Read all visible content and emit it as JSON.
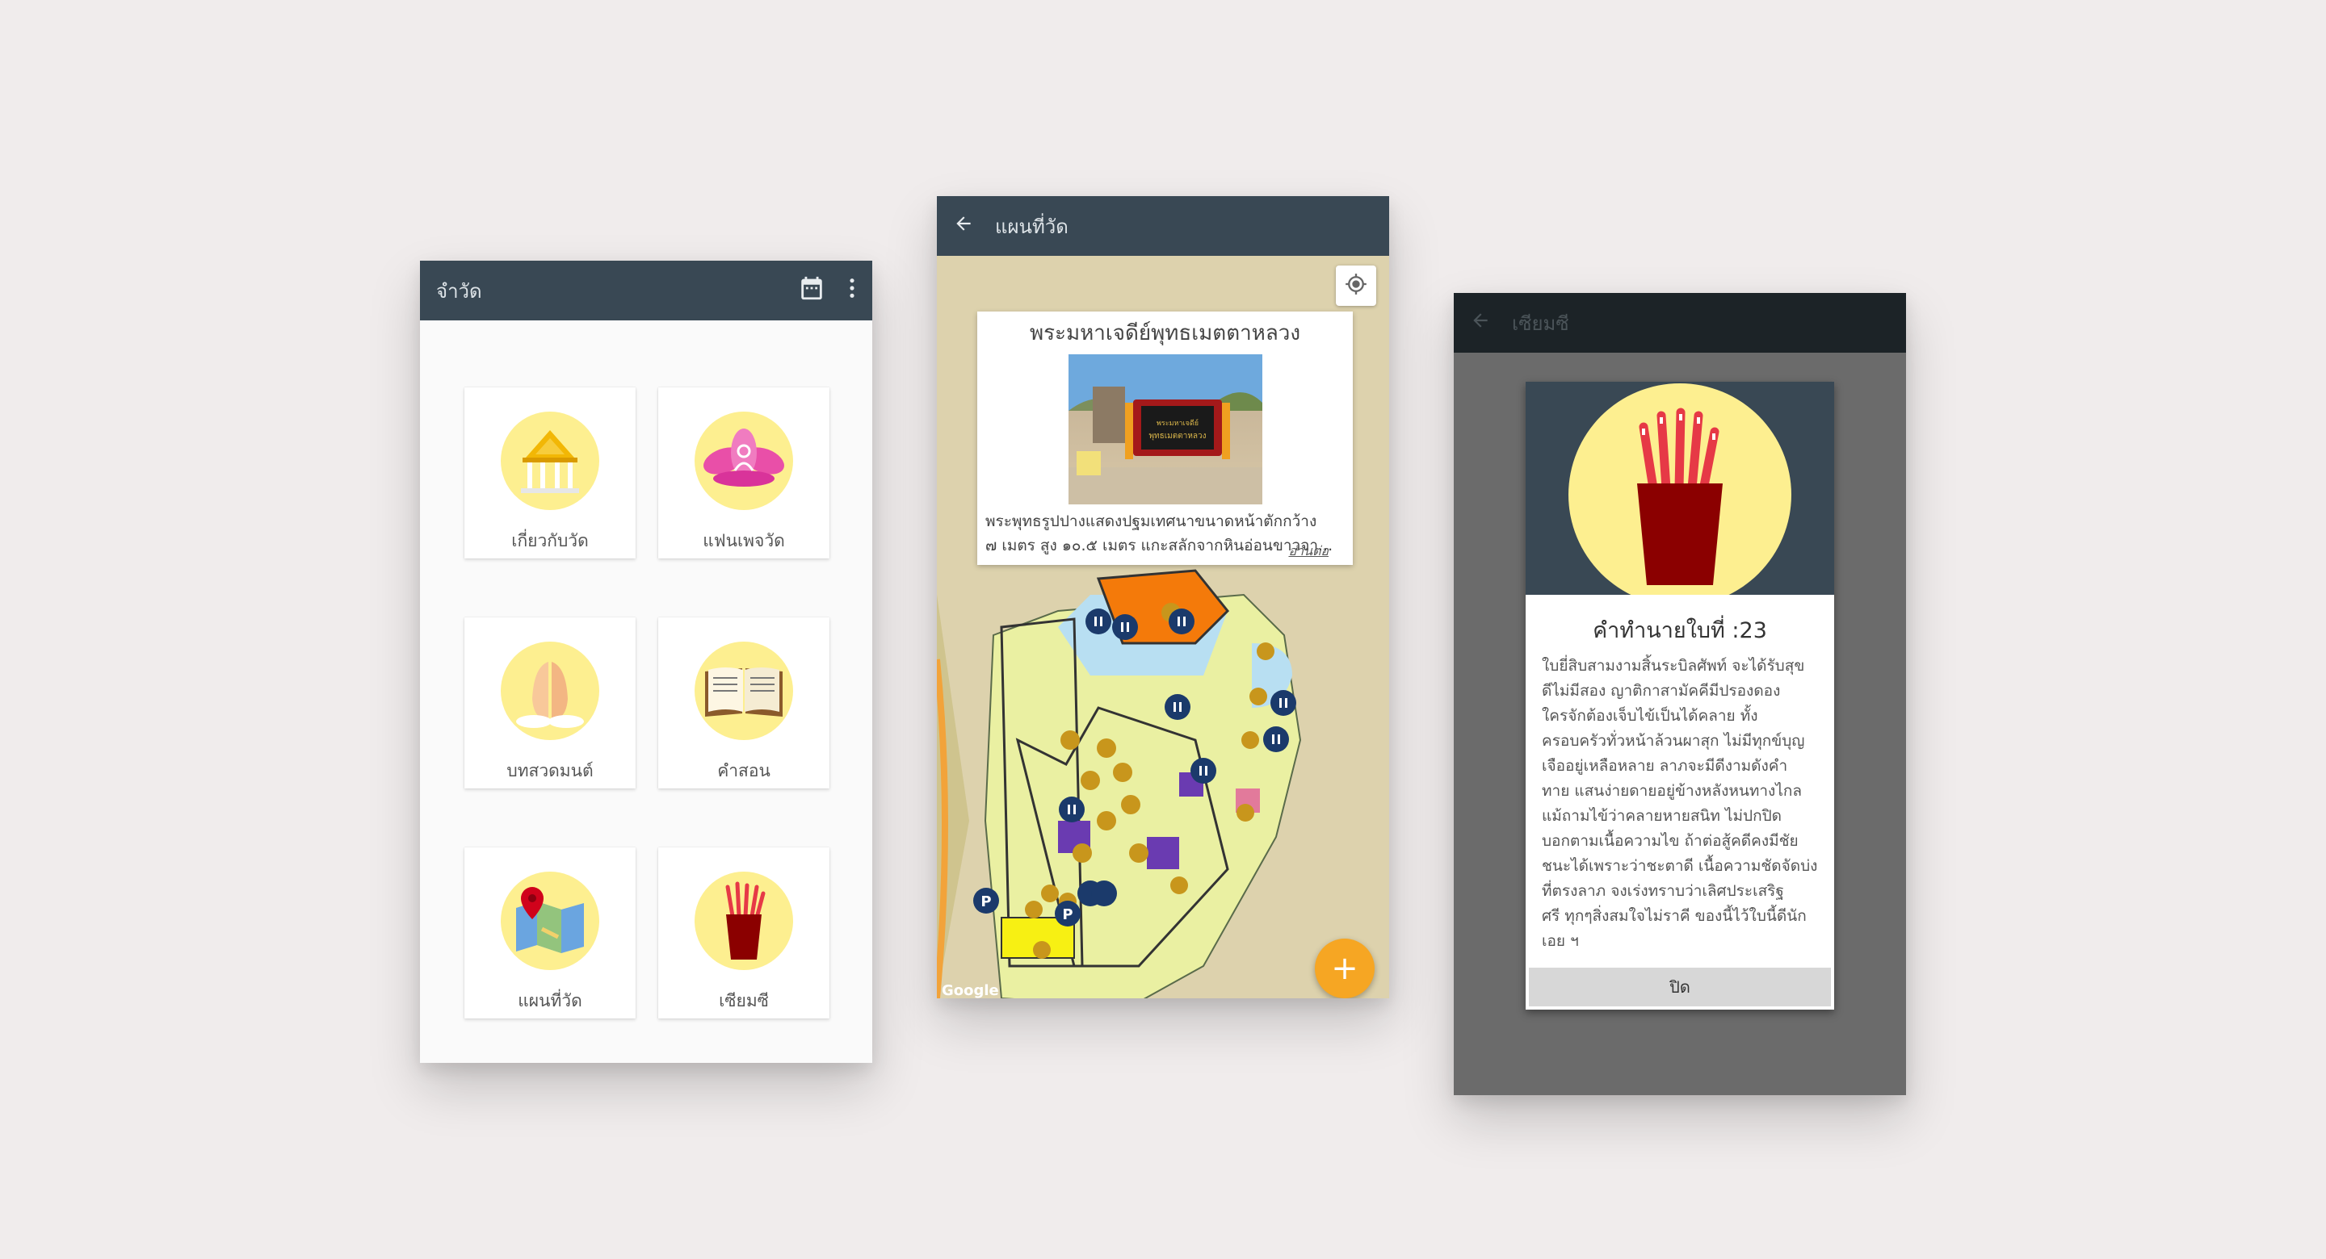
{
  "home": {
    "title": "จำวัด",
    "cards": [
      {
        "label": "เกี่ยวกับวัด",
        "icon": "temple-icon"
      },
      {
        "label": "แฟนเพจวัด",
        "icon": "lotus-icon"
      },
      {
        "label": "บทสวดมนต์",
        "icon": "praying-hands-icon"
      },
      {
        "label": "คำสอน",
        "icon": "book-icon"
      },
      {
        "label": "แผนที่วัด",
        "icon": "map-icon"
      },
      {
        "label": "เซียมซี",
        "icon": "fortune-sticks-icon"
      }
    ]
  },
  "map": {
    "title": "แผนที่วัด",
    "info": {
      "title": "พระมหาเจดีย์พุทธเมตตาหลวง",
      "line1": "พระพุทธรูปปางแสดงปฐมเทศนาขนาดหน้าตักกว้าง",
      "line2": "๗ เมตร สูง ๑๐.๕ เมตร แกะสลักจากหินอ่อนขาวจา...",
      "more": "อ่านต่อ"
    },
    "fab": "+",
    "attribution": "Google"
  },
  "fortune": {
    "title": "เซียมซี",
    "result_title": "คำทำนายใบที่ :23",
    "lines": [
      "ใบยี่สิบสามงามสิ้นระบิลศัพท์ จะได้รับสุข",
      "ดีไม่มีสอง ญาติกาสามัคคีมีปรองดอง",
      "ใครจักต้องเจ็บไข้เป็นได้คลาย ทั้ง",
      "ครอบครัวทั่วหน้าล้วนผาสุก ไม่มีทุกข์บุญ",
      "เจืออยู่เหลือหลาย ลาภจะมีดีงามดังคำ",
      "ทาย แสนง่ายดายอยู่ข้างหลังหนทางไกล",
      "แม้ถามไข้ว่าคลายหายสนิท ไม่ปกปิด",
      "บอกตามเนื้อความไข ถ้าต่อสู้คดีคงมีชัย",
      "ชนะได้เพราะว่าชะตาดี เนื้อความชัดจัดบ่ง",
      "ที่ตรงลาภ จงเร่งทราบว่าเลิศประเสริฐ",
      "ศรี ทุกๆสิ่งสมใจไม่ราคี ของนี้ไว้ใบนี้ดีนัก",
      "เอย ฯ"
    ],
    "close": "ปิด"
  }
}
